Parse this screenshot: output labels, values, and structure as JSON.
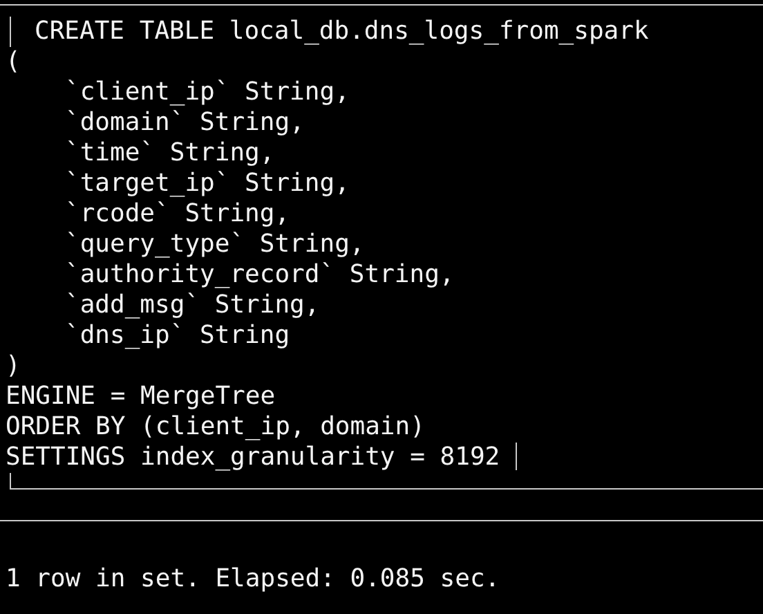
{
  "ddl": {
    "header": "CREATE TABLE local_db.dns_logs_from_spark",
    "open": "(",
    "columns": [
      "`client_ip` String,",
      "`domain` String,",
      "`time` String,",
      "`target_ip` String,",
      "`rcode` String,",
      "`query_type` String,",
      "`authority_record` String,",
      "`add_msg` String,",
      "`dns_ip` String"
    ],
    "close": ")",
    "clauses": [
      "ENGINE = MergeTree",
      "ORDER BY (client_ip, domain)",
      "SETTINGS index_granularity = 8192"
    ]
  },
  "status": "1 row in set. Elapsed: 0.085 sec."
}
